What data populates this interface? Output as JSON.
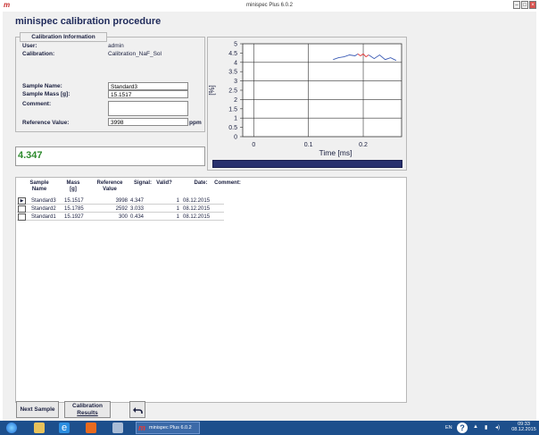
{
  "window": {
    "title": "minispec Plus 6.0.2",
    "app_icon": "m",
    "controls": [
      "–",
      "□",
      "×"
    ]
  },
  "page": {
    "title": "minispec calibration procedure"
  },
  "calibration_info": {
    "legend": "Calibration Information",
    "user_label": "User:",
    "user_value": "admin",
    "calibration_label": "Calibration:",
    "calibration_value": "Calibration_NaF_Sol",
    "sample_name_label": "Sample Name:",
    "sample_name_value": "Standard3",
    "sample_mass_label": "Sample Mass [g]:",
    "sample_mass_value": "15.1517",
    "comment_label": "Comment:",
    "comment_value": "",
    "reference_label": "Reference Value:",
    "reference_value": "3998",
    "reference_unit": "ppm"
  },
  "result": {
    "value": "4.347"
  },
  "chart_data": {
    "type": "line",
    "xlabel": "Time [ms]",
    "ylabel": "[%]",
    "xlim": [
      -0.02,
      0.27
    ],
    "ylim": [
      0,
      5
    ],
    "x_ticks": [
      "0",
      "0.1",
      "0.2"
    ],
    "y_ticks": [
      "0",
      "0.5",
      "1",
      "1.5",
      "2",
      "2.5",
      "3",
      "3.5",
      "4",
      "4.5",
      "5"
    ],
    "grid": true,
    "series": [
      {
        "color": "#3b5bb5",
        "x": [
          0.145,
          0.155,
          0.165,
          0.175,
          0.185,
          0.19
        ],
        "y": [
          4.15,
          4.25,
          4.3,
          4.4,
          4.35,
          4.45
        ]
      },
      {
        "color": "#e03030",
        "x": [
          0.19,
          0.195,
          0.2,
          0.205,
          0.21
        ],
        "y": [
          4.45,
          4.35,
          4.45,
          4.3,
          4.4
        ]
      },
      {
        "color": "#3b5bb5",
        "x": [
          0.21,
          0.22,
          0.23,
          0.24,
          0.25,
          0.26
        ],
        "y": [
          4.4,
          4.2,
          4.4,
          4.15,
          4.25,
          4.1
        ]
      }
    ]
  },
  "progress": {
    "fraction": 1.0,
    "color": "#28306e"
  },
  "table": {
    "headers": [
      "Sample Name",
      "Mass [g]",
      "Reference Value",
      "Signal:",
      "Valid?",
      "Date:",
      "Comment:"
    ],
    "rows": [
      {
        "selected": true,
        "name": "Standard3",
        "mass": "15.1517",
        "reference": "3998",
        "signal": "4.347",
        "valid": "1",
        "date": "08.12.2015",
        "comment": ""
      },
      {
        "selected": false,
        "name": "Standard2",
        "mass": "15.1785",
        "reference": "2592",
        "signal": "3.033",
        "valid": "1",
        "date": "08.12.2015",
        "comment": ""
      },
      {
        "selected": false,
        "name": "Standard1",
        "mass": "15.1927",
        "reference": "300",
        "signal": "0.434",
        "valid": "1",
        "date": "08.12.2015",
        "comment": ""
      }
    ]
  },
  "buttons": {
    "next_sample": "Next Sample",
    "calibration_results_line1": "Calibration",
    "calibration_results_line2": "Results",
    "undo_icon": "undo-arrow-icon"
  },
  "taskbar": {
    "task_label": "minispec Plus 6.0.2",
    "lang": "EN",
    "time": "09:33",
    "date": "08.12.2015"
  }
}
